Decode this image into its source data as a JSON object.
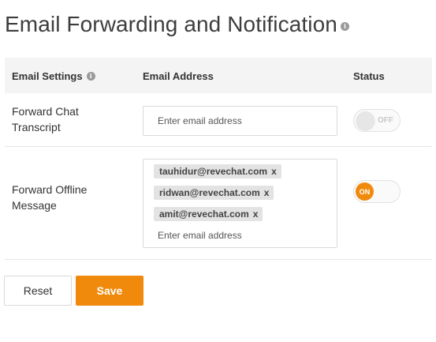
{
  "page": {
    "title": "Email Forwarding and Notification",
    "info_icon": "i"
  },
  "table": {
    "headers": {
      "settings": "Email Settings",
      "email": "Email Address",
      "status": "Status"
    },
    "rows": [
      {
        "label": "Forward Chat Transcript",
        "emails": [],
        "placeholder": "Enter email address",
        "status": "OFF"
      },
      {
        "label": "Forward Offline Message",
        "emails": [
          {
            "address": "tauhidur@revechat.com",
            "remove": "x"
          },
          {
            "address": "ridwan@revechat.com",
            "remove": "x"
          },
          {
            "address": "amit@revechat.com",
            "remove": "x"
          }
        ],
        "placeholder": "Enter email address",
        "status": "ON"
      }
    ]
  },
  "actions": {
    "reset_label": "Reset",
    "save_label": "Save"
  },
  "colors": {
    "accent": "#f08a0c",
    "header_bg": "#f4f4f4",
    "tag_bg": "#e3e3e3"
  }
}
